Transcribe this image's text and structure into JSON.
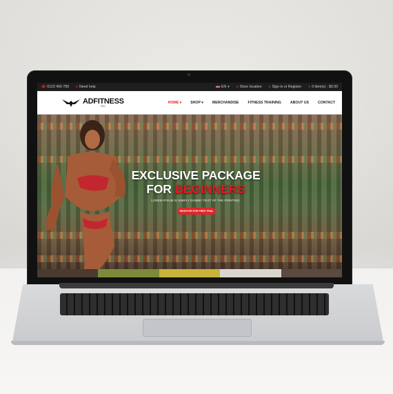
{
  "topbar": {
    "phone": "0123 456 789",
    "help": "Need help",
    "language": "EN",
    "store": "Store location",
    "signin": "Sign in or Register",
    "cart": "0 item(s) - $0.00"
  },
  "brand": {
    "name": "ADFITNESS",
    "sub": "INC"
  },
  "menu": [
    "HOME",
    "SHOP",
    "MERCHANDISE",
    "FITNESS TRAINING",
    "ABOUT US",
    "CONTACT"
  ],
  "hero": {
    "line1": "EXCLUSIVE PACKAGE",
    "line2_white": "FOR",
    "line2_red": "BEGINNERS",
    "subtitle": "LOREM IPSUM IS SIMPLY DUMMY TEXT OF THE PRINTING.",
    "button": "REGISTER FOR FREE TRIAL"
  },
  "colors": {
    "accent": "#e0262a",
    "topbar": "#1e1e1e"
  }
}
